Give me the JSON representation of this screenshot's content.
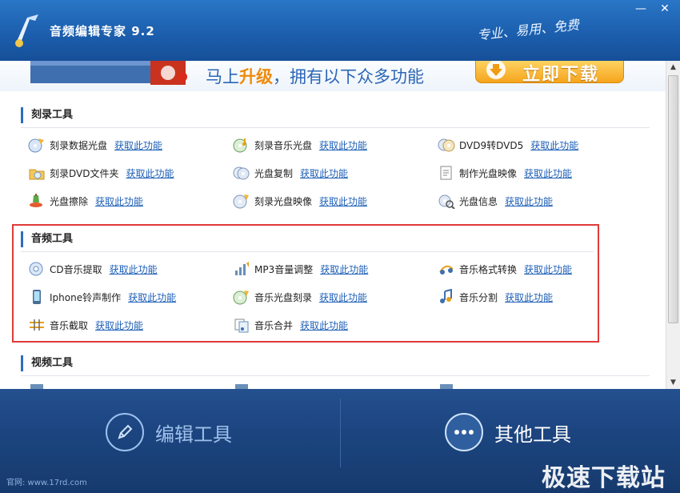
{
  "window": {
    "title": "音频编辑专家 9.2",
    "slogan": "专业、易用、免费",
    "minimize": "—",
    "close": "✕"
  },
  "banner": {
    "text_prefix": "马上",
    "text_highlight": "升级",
    "text_suffix": "，拥有以下众多功能",
    "download_label": "立即下载"
  },
  "link_label": "获取此功能",
  "sections": [
    {
      "title": "刻录工具",
      "items": [
        {
          "label": "刻录数据光盘",
          "icon": "disc-burn-icon"
        },
        {
          "label": "刻录音乐光盘",
          "icon": "music-disc-icon"
        },
        {
          "label": "DVD9转DVD5",
          "icon": "dvd-convert-icon"
        },
        {
          "label": "刻录DVD文件夹",
          "icon": "dvd-folder-icon"
        },
        {
          "label": "光盘复制",
          "icon": "disc-copy-icon"
        },
        {
          "label": "制作光盘映像",
          "icon": "disc-image-icon"
        },
        {
          "label": "光盘擦除",
          "icon": "disc-erase-icon"
        },
        {
          "label": "刻录光盘映像",
          "icon": "burn-image-icon"
        },
        {
          "label": "光盘信息",
          "icon": "disc-info-icon"
        }
      ]
    },
    {
      "title": "音频工具",
      "items": [
        {
          "label": "CD音乐提取",
          "icon": "cd-extract-icon"
        },
        {
          "label": "MP3音量调整",
          "icon": "volume-adjust-icon"
        },
        {
          "label": "音乐格式转换",
          "icon": "format-convert-icon"
        },
        {
          "label": "Iphone铃声制作",
          "icon": "ringtone-icon"
        },
        {
          "label": "音乐光盘刻录",
          "icon": "music-burn-icon"
        },
        {
          "label": "音乐分割",
          "icon": "music-split-icon"
        },
        {
          "label": "音乐截取",
          "icon": "music-cut-icon"
        },
        {
          "label": "音乐合并",
          "icon": "music-merge-icon"
        }
      ]
    },
    {
      "title": "视频工具",
      "items": []
    }
  ],
  "bottom": {
    "edit_tools": "编辑工具",
    "other_tools": "其他工具"
  },
  "watermark": "极速下载站",
  "footer_url": "官网: www.17rd.com",
  "colors": {
    "accent": "#2e6cc0",
    "link": "#1d5fb7",
    "highlight": "#e03a3a",
    "download": "#f5a41c"
  }
}
